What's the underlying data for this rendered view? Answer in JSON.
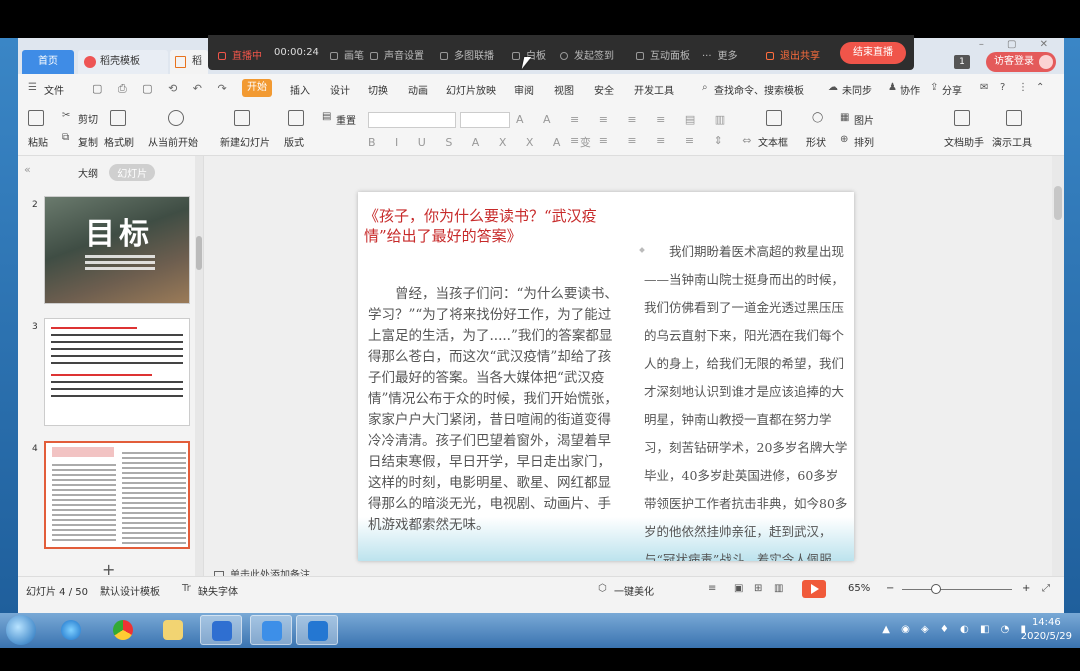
{
  "live_toolbar": {
    "live_label": "直播中",
    "timer": "00:00:24",
    "items": [
      "画笔",
      "声音设置",
      "多图联播",
      "白板",
      "发起签到",
      "互动面板",
      "更多"
    ],
    "exit_share": "退出共享",
    "end_live": "结束直播"
  },
  "tabs": {
    "home": "首页",
    "templates": "稻壳模板",
    "doc": "稻"
  },
  "window": {
    "badge": "1",
    "visitor_login": "访客登录",
    "controls": "– ▢ ✕"
  },
  "menu": {
    "file": "文件",
    "quick_icons": "▢ ⎙ ▢ ⟲ ↶ ↷",
    "start": "开始",
    "items": [
      "插入",
      "设计",
      "切换",
      "动画",
      "幻灯片放映",
      "审阅",
      "视图",
      "安全",
      "开发工具"
    ],
    "search": "查找命令、搜索模板",
    "unsynced": "未同步",
    "collab": "协作",
    "share": "分享"
  },
  "ribbon": {
    "paste": "粘贴",
    "cut": "剪切",
    "copy": "复制",
    "format_painter": "格式刷",
    "from_current": "从当前开始",
    "new_slide": "新建幻灯片",
    "layout": "版式",
    "reset": "重置",
    "picture": "图片",
    "textbox": "文本框",
    "shape": "形状",
    "arrange": "排列",
    "doc_helper": "文档助手",
    "present_tools": "演示工具"
  },
  "left_panel": {
    "tab_outline": "大纲",
    "tab_slides": "幻灯片",
    "thumbs": [
      {
        "num": "2",
        "title": "目标"
      },
      {
        "num": "3"
      },
      {
        "num": "4"
      }
    ]
  },
  "slide": {
    "title": "《孩子，你为什么要读书？“武汉疫情”给出了最好的答案》",
    "left_text": "曾经，当孩子们问：“为什么要读书、学习？”“为了将来找份好工作，为了能过上富足的生活，为了.....”我们的答案都显得那么苍白，而这次“武汉疫情”却给了孩子们最好的答案。当各大媒体把“武汉疫情”情况公布于众的时候，我们开始慌张，家家户户大门紧闭，昔日喧闹的街道变得冷冷清清。孩子们巴望着窗外，渴望着早日结束寒假，早日开学，早日走出家门，这样的时刻，电影明星、歌星、网红都显得那么的暗淡无光，电视剧、动画片、手机游戏都索然无味。",
    "right_text": "我们期盼着医术高超的救星出现——当钟南山院士挺身而出的时候，我们仿佛看到了一道金光透过黑压压的乌云直射下来，阳光洒在我们每个人的身上，给我们无限的希望，我们才深刻地认识到谁才是应该追捧的大明星，钟南山教授一直都在努力学习，刻苦钻研学术，20多岁名牌大学毕业，40多岁赴英国进修，60多岁带领医护工作者抗击非典，如今80多岁的他依然挂帅亲征，赶到武汉，与“冠状病毒”战斗，着实令人佩服。"
  },
  "notes_placeholder": "单击此处添加备注",
  "statusbar": {
    "slide_counter": "幻灯片 4 / 50",
    "template": "默认设计模板",
    "missing_font": "缺失字体",
    "beautify": "一键美化",
    "zoom": "65%",
    "zoom_minus": "−",
    "zoom_plus": "+"
  },
  "taskbar": {
    "time": "14:46",
    "date": "2020/5/29"
  }
}
